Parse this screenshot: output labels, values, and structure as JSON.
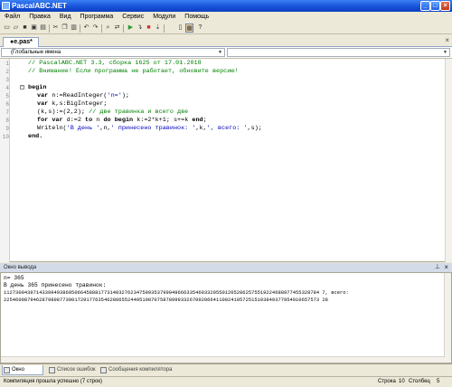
{
  "window": {
    "title": "PascalABC.NET"
  },
  "menu": [
    "Файл",
    "Правка",
    "Вид",
    "Программа",
    "Сервис",
    "Модули",
    "Помощь"
  ],
  "toolbar": {
    "icons": [
      "new-file-icon",
      "open-icon",
      "save-icon",
      "save-all-icon",
      "print-icon",
      "cut-icon",
      "copy-icon",
      "paste-icon",
      "undo-icon",
      "redo-icon",
      "find-icon",
      "replace-icon",
      "run-icon",
      "step-icon",
      "stop-icon",
      "debug-icon",
      "output-window-icon",
      "help-icon"
    ]
  },
  "tab": {
    "label": "●e.pas*"
  },
  "scope": {
    "left": "(Глобальные имена",
    "right": ""
  },
  "code": {
    "line1": "// PascalABC.NET 3.3, сборка 1625 от 17.01.2018",
    "line2": "// Внимание! Если программа не работает, обновите версию!",
    "begin": "begin",
    "var_n_kw": "var",
    "var_n_rest": " n:=ReadInteger(",
    "var_n_str": "'n='",
    "var_n_end": ");",
    "var_ks_kw": "var",
    "var_ks_rest": " k,s:BigInteger;",
    "tuple": "(k,s):=(2,2);",
    "tuple_comment": " // две травинка и всего две",
    "for_kw": "for var",
    "for_mid1": " d:=2 ",
    "for_to": "to",
    "for_mid2": " n ",
    "for_do": "do begin",
    "for_mid3": " k:=2*k+1; s+=k ",
    "for_end": "end",
    "for_semi": ";",
    "writeln_a": "Writeln(",
    "writeln_s1": "'В день '",
    "writeln_b": ",n,",
    "writeln_s2": "' принесено травинок: '",
    "writeln_c": ",k,",
    "writeln_s3": "', всего: '",
    "writeln_d": ",s);",
    "end": "end."
  },
  "line_numbers": [
    "1",
    "2",
    "3",
    "4",
    "5",
    "6",
    "7",
    "8",
    "9",
    "10"
  ],
  "output": {
    "title": "Окно вывода",
    "lines": [
      "n= 365",
      "В день 365 принесено травинок:",
      "11273004397143399493869506645888177314032762347599353799949666335460332055012052862575519224688977455328784 7, всего:",
      "22546008794628798987739017291776354628065524495198707587899933267092066411002410572515103849377954910657573 28"
    ]
  },
  "bottom_tabs": [
    "Окно вывода",
    "Список ошибок",
    "Сообщения компилятора"
  ],
  "status": {
    "message": "Компиляция прошла успешно (7 строк)",
    "row_label": "Строка",
    "row": "10",
    "col_label": "Столбец",
    "col": "5"
  }
}
